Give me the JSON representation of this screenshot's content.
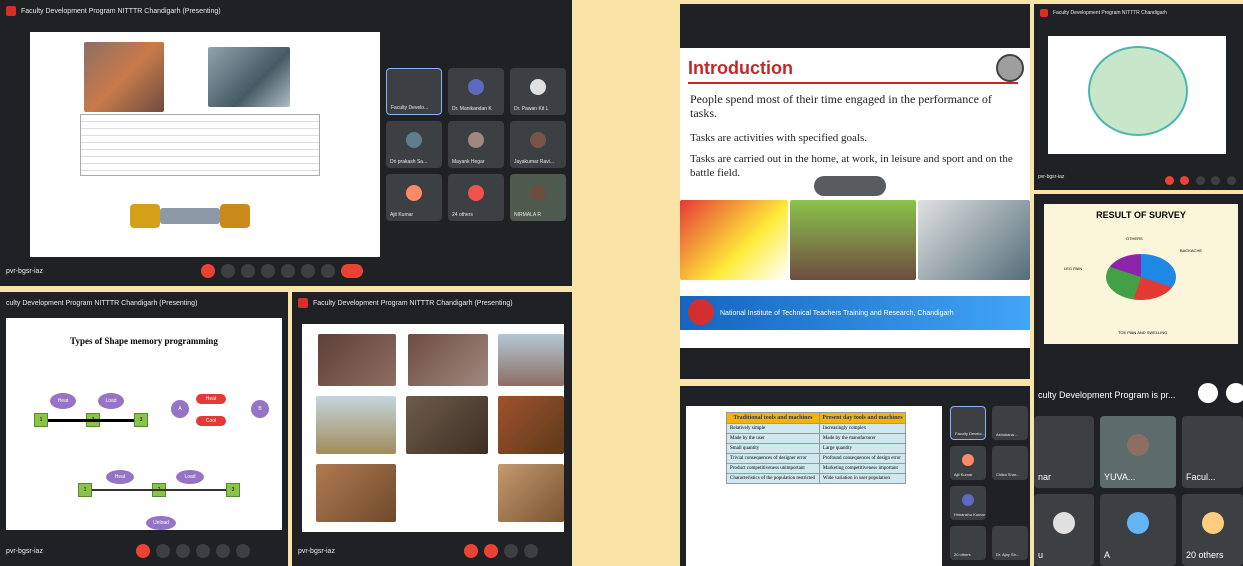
{
  "colors": {
    "background": "#f9e3a6",
    "meet_dark": "#202124",
    "tile": "#3c4043",
    "end_call": "#ea4335",
    "accent_purple": "#9573c5"
  },
  "win1": {
    "title": "Faculty Development Program NITTTR Chandigarh (Presenting)",
    "meet_code": "pvr-bgsr-iaz",
    "participants": [
      "Faculty Develo...",
      "Dr. Manikandan K",
      "Dr. Pawan Kit L",
      "Dri prakash Sa...",
      "Mayank Hegar",
      "Jayakumar Ravi...",
      "Ajit Kumar",
      "24 others",
      "NIRMALA R"
    ]
  },
  "win2": {
    "title": "culty Development Program NITTTR Chandigarh (Presenting)",
    "slide_title": "Types of Shape memory programming",
    "meet_code": "pvr-bgsr-iaz"
  },
  "win3": {
    "title": "Faculty Development Program NITTTR Chandigarh (Presenting)",
    "meet_code": "pvr-bgsr-iaz"
  },
  "win4": {
    "slide_title": "Introduction",
    "lines": [
      "People spend most of their time engaged in the performance of tasks.",
      "Tasks are activities with specified goals.",
      "Tasks are carried out in the home, at work, in leisure and sport and on the battle field."
    ],
    "banner": "National Institute of Technical Teachers Training and Research, Chandigarh"
  },
  "win5": {
    "title": "Faculty Development Program NITTTR Chandigarh",
    "meet_code": "pvr-bgsr-iaz"
  },
  "win6": {
    "slide_title": "RESULT OF SURVEY",
    "labels": {
      "others": "OTHERS",
      "backache": "BACKACHE",
      "leg_pain": "LEG PAIN",
      "toe": "TOE PAIN AND SWELLING"
    },
    "presenting_banner": "culty Development Program is pr..."
  },
  "win6_tiles": [
    "nar",
    "YUVA...",
    "Facul...",
    "u",
    "A",
    "20 others"
  ],
  "win7": {
    "headers": [
      "Traditional tools and machines",
      "Present day tools and machines"
    ],
    "rows": [
      [
        "Relatively simple",
        "Increasingly complex"
      ],
      [
        "Made by the user",
        "Made by the manufacturer"
      ],
      [
        "Small quantity",
        "Large quantity"
      ],
      [
        "Trivial consequences of designer error",
        "Profound consequences of design error"
      ],
      [
        "Product competitiveness unimportant",
        "Marketing competitiveness important"
      ],
      [
        "Characteristics of the population restricted",
        "Wide variation in user population"
      ]
    ],
    "side_tiles": [
      "Faculty Develo...",
      "Ajit Kumar",
      "Ashokana...",
      "Himanshu Kumar",
      "Chitra Shar...",
      "20 others",
      "Dr. Ajay Sh..."
    ]
  }
}
